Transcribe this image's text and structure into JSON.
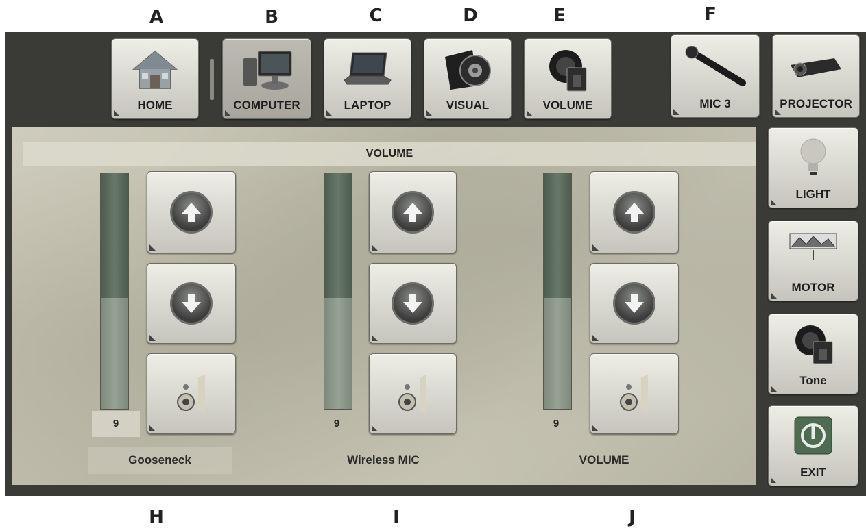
{
  "callouts": {
    "a": "A",
    "b": "B",
    "c": "C",
    "d": "D",
    "e": "E",
    "f": "F",
    "h": "H",
    "i": "I",
    "j": "J"
  },
  "top_nav": {
    "home": {
      "label": "HOME",
      "icon": "house-icon"
    },
    "computer": {
      "label": "COMPUTER",
      "icon": "desktop-computer-icon",
      "selected": true
    },
    "laptop": {
      "label": "LAPTOP",
      "icon": "laptop-icon"
    },
    "visual": {
      "label": "VISUAL",
      "icon": "document-camera-icon"
    },
    "volume": {
      "label": "VOLUME",
      "icon": "speaker-volume-icon"
    },
    "mic3": {
      "label": "MIC 3",
      "icon": "microphone-icon"
    },
    "projector": {
      "label": "PROJECTOR",
      "icon": "projector-icon"
    }
  },
  "side_nav": {
    "light": {
      "label": "LIGHT",
      "icon": "light-bulb-icon"
    },
    "motor": {
      "label": "MOTOR",
      "icon": "projection-screen-icon"
    },
    "tone": {
      "label": "Tone",
      "icon": "speaker-tone-icon"
    },
    "exit": {
      "label": "EXIT",
      "icon": "power-icon"
    }
  },
  "volume_panel": {
    "title": "VOLUME",
    "channels": [
      {
        "name": "Gooseneck",
        "level": "9",
        "level_fraction": 0.47
      },
      {
        "name": "Wireless MIC",
        "level": "9",
        "level_fraction": 0.47
      },
      {
        "name": "VOLUME",
        "level": "9",
        "level_fraction": 0.47
      }
    ]
  },
  "colors": {
    "frame": "#3a3b37",
    "panel_texture": "#c4c1b1",
    "meter_dark": "#4d5c4b",
    "meter_fill": "#8d9a8b",
    "button_face": "#dcdbd4"
  }
}
